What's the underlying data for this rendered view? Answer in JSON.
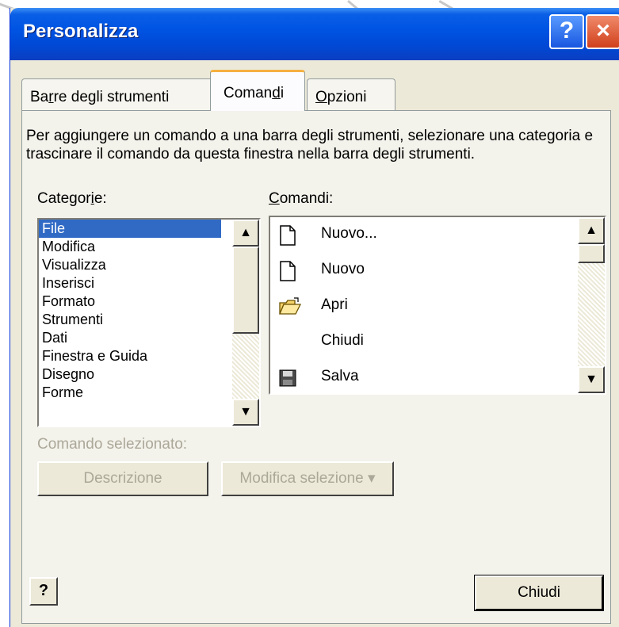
{
  "window": {
    "title": "Personalizza",
    "help_glyph": "?",
    "close_glyph": "×"
  },
  "tabs": [
    {
      "label_a": "Ba",
      "label_u": "r",
      "label_b": "re degli strumenti"
    },
    {
      "label_a": "Coman",
      "label_u": "d",
      "label_b": "i"
    },
    {
      "label_a": "",
      "label_u": "O",
      "label_b": "pzioni"
    }
  ],
  "description": "Per aggiungere un comando a una barra degli strumenti, selezionare una categoria e trascinare il comando da questa finestra nella barra degli strumenti.",
  "categories_label_a": "Categor",
  "categories_label_u": "i",
  "categories_label_b": "e:",
  "commands_label_u": "C",
  "commands_label_b": "omandi:",
  "categories": [
    "File",
    "Modifica",
    "Visualizza",
    "Inserisci",
    "Formato",
    "Strumenti",
    "Dati",
    "Finestra e Guida",
    "Disegno",
    "Forme"
  ],
  "commands": [
    {
      "label": "Nuovo...",
      "icon": "new-document-icon"
    },
    {
      "label": "Nuovo",
      "icon": "new-document-icon"
    },
    {
      "label": "Apri",
      "icon": "open-folder-icon"
    },
    {
      "label": "Chiudi",
      "icon": ""
    },
    {
      "label": "Salva",
      "icon": "save-disk-icon"
    }
  ],
  "selected_command_label": "Comando selezionato:",
  "buttons": {
    "descrizione": "Descrizione",
    "modifica_selezione": "Modifica selezione",
    "chiudi": "Chiudi",
    "help_icon": "?"
  },
  "scroll_glyphs": {
    "up": "▲",
    "down": "▼",
    "dropdown": "▾"
  },
  "colors": {
    "title_bar": "#0054e3",
    "selection": "#316ac5",
    "dialog_bg": "#ece9d8",
    "close_button": "#d0401c"
  }
}
